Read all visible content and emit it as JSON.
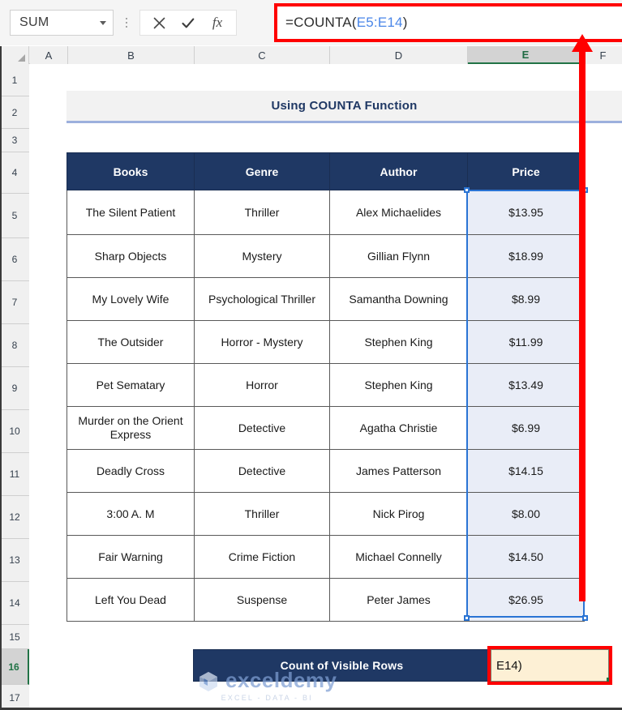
{
  "formula_bar": {
    "name_box_value": "SUM",
    "name_box_caret_icon": "chevron-down-icon",
    "cancel_icon": "close-icon",
    "confirm_icon": "check-icon",
    "insert_function_icon": "fx-icon",
    "insert_function_label": "fx",
    "formula_prefix": "=COUNTA(",
    "formula_reference": "E5:E14",
    "formula_suffix": ")",
    "reference_color": "#4a86e8",
    "highlight_color": "#ff0000"
  },
  "columns": [
    {
      "label": "A",
      "active": false
    },
    {
      "label": "B",
      "active": false
    },
    {
      "label": "C",
      "active": false
    },
    {
      "label": "D",
      "active": false
    },
    {
      "label": "E",
      "active": true
    },
    {
      "label": "F",
      "active": false
    }
  ],
  "rows": [
    {
      "label": "1",
      "active": false
    },
    {
      "label": "2",
      "active": false
    },
    {
      "label": "3",
      "active": false
    },
    {
      "label": "4",
      "active": false
    },
    {
      "label": "5",
      "active": false
    },
    {
      "label": "6",
      "active": false
    },
    {
      "label": "7",
      "active": false
    },
    {
      "label": "8",
      "active": false
    },
    {
      "label": "9",
      "active": false
    },
    {
      "label": "10",
      "active": false
    },
    {
      "label": "11",
      "active": false
    },
    {
      "label": "12",
      "active": false
    },
    {
      "label": "13",
      "active": false
    },
    {
      "label": "14",
      "active": false
    },
    {
      "label": "15",
      "active": false
    },
    {
      "label": "16",
      "active": true
    },
    {
      "label": "17",
      "active": false
    }
  ],
  "sheet": {
    "title": "Using COUNTA Function",
    "title_color": "#1f3864",
    "header_bg": "#1f3864",
    "headers": [
      "Books",
      "Genre",
      "Author",
      "Price"
    ],
    "data": [
      [
        "The Silent Patient",
        "Thriller",
        "Alex Michaelides",
        "$13.95"
      ],
      [
        "Sharp Objects",
        "Mystery",
        "Gillian Flynn",
        "$18.99"
      ],
      [
        "My Lovely Wife",
        "Psychological Thriller",
        "Samantha Downing",
        "$8.99"
      ],
      [
        "The Outsider",
        "Horror - Mystery",
        "Stephen King",
        "$11.99"
      ],
      [
        "Pet Sematary",
        "Horror",
        "Stephen King",
        "$13.49"
      ],
      [
        "Murder on the Orient Express",
        "Detective",
        "Agatha Christie",
        "$6.99"
      ],
      [
        "Deadly Cross",
        "Detective",
        "James Patterson",
        "$14.15"
      ],
      [
        "3:00 A. M",
        "Thriller",
        "Nick Pirog",
        "$8.00"
      ],
      [
        "Fair Warning",
        "Crime Fiction",
        "Michael Connelly",
        "$14.50"
      ],
      [
        "Left You Dead",
        "Suspense",
        "Peter James",
        "$26.95"
      ]
    ],
    "summary_label": "Count of Visible Rows",
    "active_cell_text": "E14)",
    "selected_range": "E5:E14",
    "selection_color": "#2a74d4",
    "price_cell_bg": "#e9edf7"
  },
  "watermark": {
    "brand": "exceldemy",
    "tagline": "EXCEL - DATA - BI"
  }
}
